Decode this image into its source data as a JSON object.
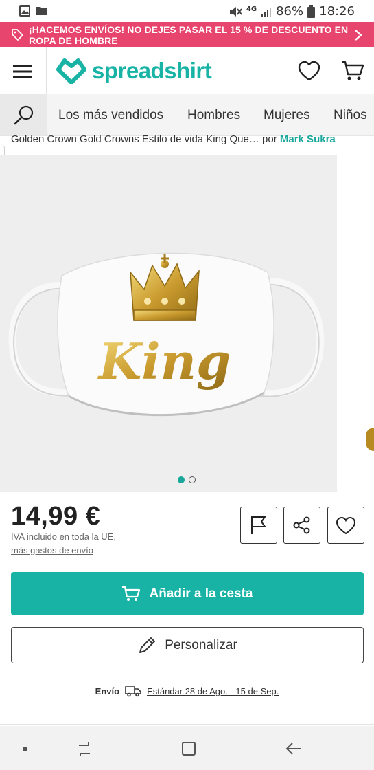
{
  "status_bar": {
    "battery": "86%",
    "time": "18:26",
    "network": "4G",
    "icons": [
      "gallery-icon",
      "folder-icon",
      "mute-icon",
      "signal-icon",
      "battery-icon"
    ]
  },
  "promo": {
    "text": "¡HACEMOS ENVÍOS! NO DEJES PASAR EL 15 % DE DESCUENTO EN ROPA DE HOMBRE"
  },
  "header": {
    "logo_text": "spreadshirt",
    "brand_color": "#19b3a6"
  },
  "nav": {
    "items": [
      "Los más vendidos",
      "Hombres",
      "Mujeres",
      "Niños"
    ]
  },
  "breadcrumb": {
    "title": "Golden Crown Gold Crowns Estilo de vida King Que…",
    "by": "por",
    "author": "Mark Sukra"
  },
  "product": {
    "image_text": "King",
    "image_count": 2,
    "active_image": 1
  },
  "price": {
    "amount": "14,99 €",
    "vat_note": "IVA incluido en toda la UE,",
    "shipping_link": "más gastos de envío"
  },
  "actions": {
    "add_to_cart": "Añadir a la cesta",
    "customize": "Personalizar"
  },
  "delivery": {
    "label": "Envío",
    "estimate": "Estándar 28 de Ago. - 15 de Sep."
  },
  "colors": {
    "promo": "#e8456e",
    "accent": "#19b3a6",
    "author_link": "#19a79b"
  }
}
